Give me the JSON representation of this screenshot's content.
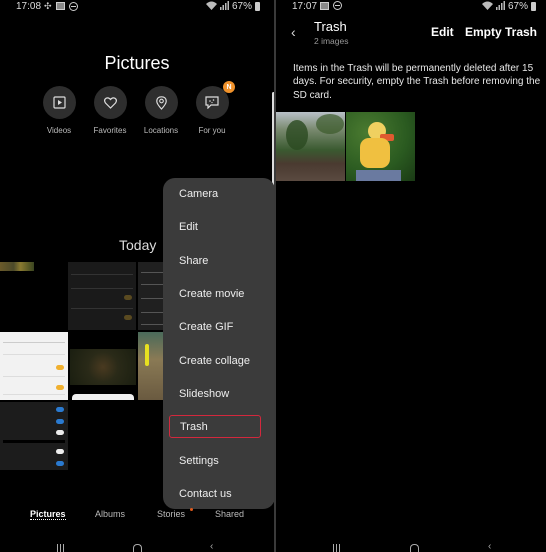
{
  "left_screen": {
    "status_bar": {
      "time": "17:08",
      "battery": "67%"
    },
    "title": "Pictures",
    "quick_links": [
      {
        "label": "Videos",
        "icon": "video-icon"
      },
      {
        "label": "Favorites",
        "icon": "heart-icon"
      },
      {
        "label": "Locations",
        "icon": "location-pin-icon"
      },
      {
        "label": "For you",
        "icon": "for-you-icon",
        "badge": "N"
      }
    ],
    "section_header": "Today",
    "menu": {
      "items": [
        {
          "label": "Camera"
        },
        {
          "label": "Edit"
        },
        {
          "label": "Share"
        },
        {
          "label": "Create movie"
        },
        {
          "label": "Create GIF"
        },
        {
          "label": "Create collage"
        },
        {
          "label": "Slideshow"
        },
        {
          "label": "Trash",
          "highlighted": true
        },
        {
          "label": "Settings"
        },
        {
          "label": "Contact us"
        }
      ],
      "highlight_color": "#d3283d"
    },
    "bottom_tabs": [
      {
        "label": "Pictures",
        "active": true
      },
      {
        "label": "Albums"
      },
      {
        "label": "Stories",
        "has_dot": true
      },
      {
        "label": "Shared"
      }
    ]
  },
  "right_screen": {
    "status_bar": {
      "time": "17:07",
      "battery": "67%"
    },
    "title": "Trash",
    "subtitle": "2 images",
    "edit_label": "Edit",
    "empty_label": "Empty Trash",
    "info_text": "Items in the Trash will be permanently deleted after 15 days. For security, empty the Trash before removing the SD card."
  },
  "colors": {
    "badge": "#f0922b",
    "accent_dot": "#e05a1c",
    "menu_bg": "#3b3b3b"
  }
}
